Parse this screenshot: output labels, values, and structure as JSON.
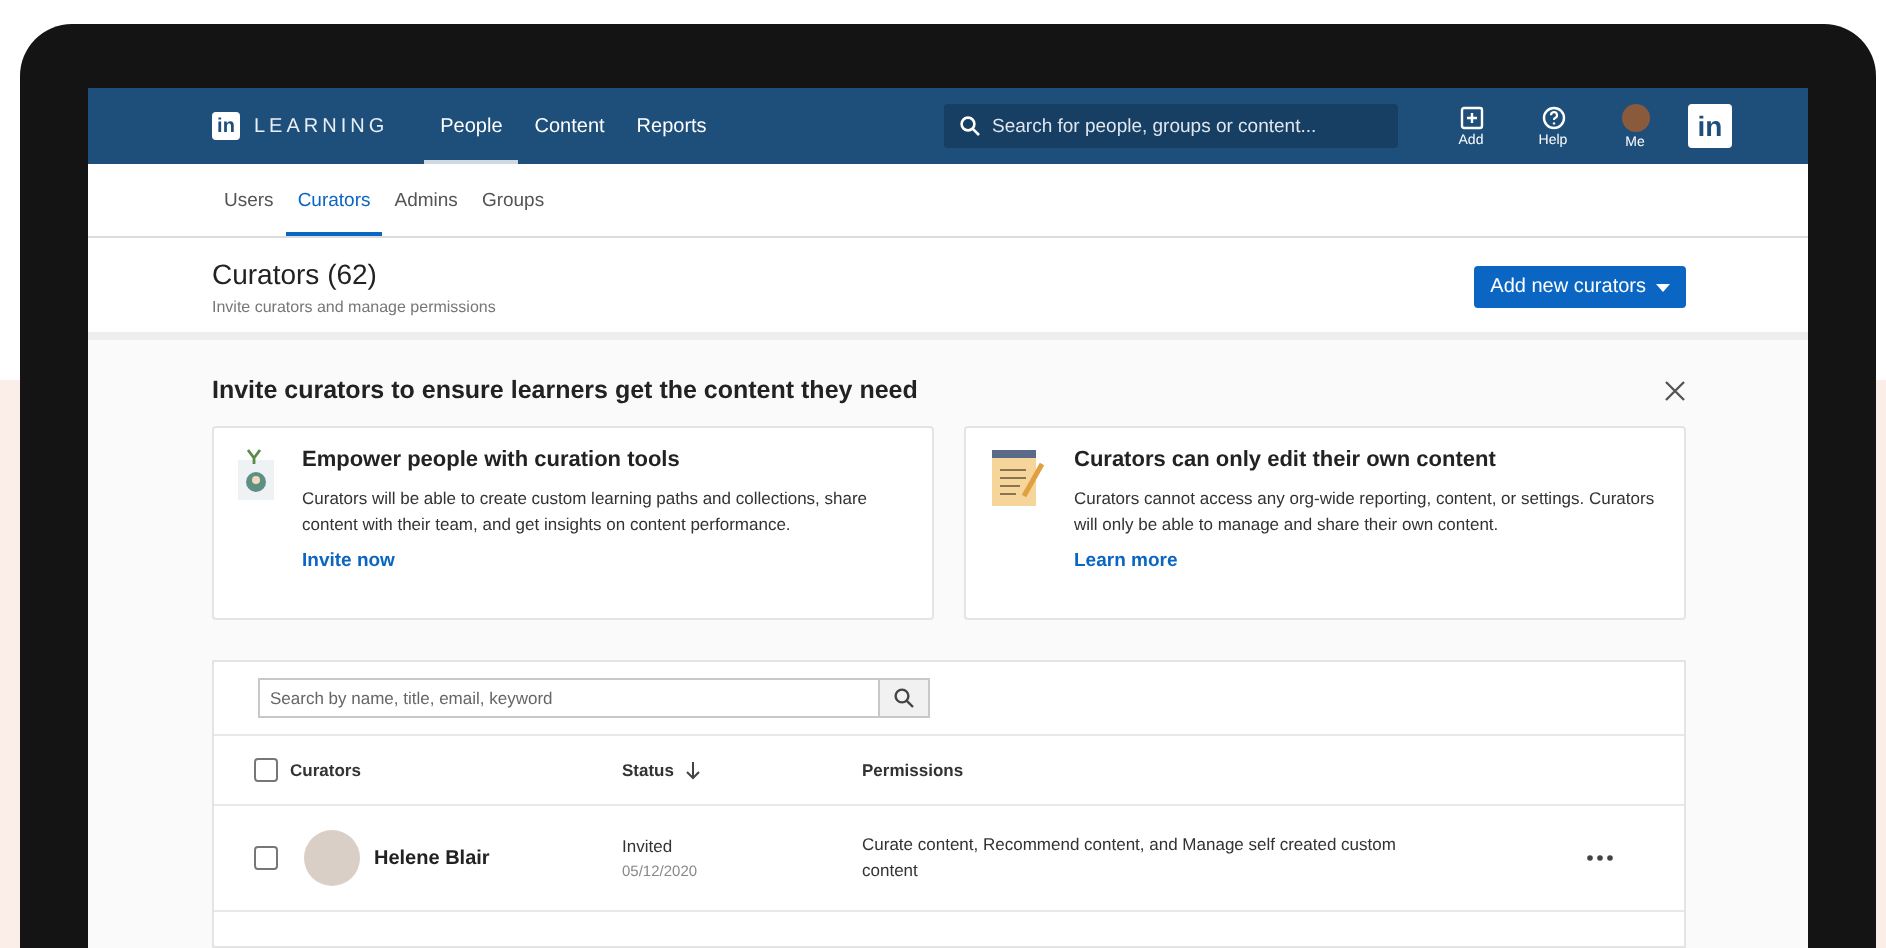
{
  "navbar": {
    "logo_badge": "in",
    "logo_text": "LEARNING",
    "nav_items": [
      {
        "label": "People",
        "selected": true
      },
      {
        "label": "Content",
        "selected": false
      },
      {
        "label": "Reports",
        "selected": false
      }
    ],
    "search": {
      "placeholder": "Search for people, groups or content..."
    },
    "actions": [
      {
        "kind": "add",
        "label": "Add"
      },
      {
        "kind": "help",
        "label": "Help"
      },
      {
        "kind": "avatar",
        "label": "Me"
      }
    ],
    "brand_badge": "in"
  },
  "subtabs": [
    {
      "label": "Users",
      "selected": false
    },
    {
      "label": "Curators",
      "selected": true
    },
    {
      "label": "Admins",
      "selected": false
    },
    {
      "label": "Groups",
      "selected": false
    }
  ],
  "header": {
    "title": "Curators (62)",
    "subtitle": "Invite curators and manage permissions",
    "button": "Add new curators"
  },
  "invite": {
    "title": "Invite curators to ensure learners get the content they need",
    "cards": [
      {
        "kind": "people",
        "title": "Empower people with curation tools",
        "body": "Curators will be able to create custom learning paths and collections, share content with their team, and get insights on content performance.",
        "link": "Invite now"
      },
      {
        "kind": "notepad",
        "title": "Curators can only edit their own content",
        "body": "Curators cannot access any org-wide reporting, content, or settings. Curators will only be able to manage and share their own content.",
        "link": "Learn more"
      }
    ]
  },
  "table": {
    "search": {
      "placeholder": "Search by name, title, email, keyword"
    },
    "select_all_checked": false,
    "columns": [
      {
        "label": "Curators",
        "sorted": false
      },
      {
        "label": "Status",
        "sorted": true
      },
      {
        "label": "Permissions",
        "sorted": false
      }
    ],
    "rows": [
      {
        "checked": false,
        "name": "Helene Blair",
        "status": "Invited",
        "date": "05/12/2020",
        "permissions": "Curate content, Recommend content, and Manage self created custom content"
      }
    ]
  }
}
